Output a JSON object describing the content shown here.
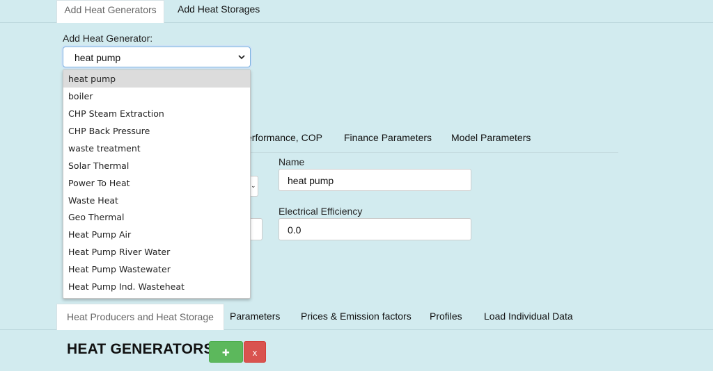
{
  "top_tabs": {
    "add_heat_generators": "Add Heat Generators",
    "add_heat_storages": "Add Heat Storages"
  },
  "generator_select": {
    "label": "Add Heat Generator:",
    "value": "heat pump",
    "options": [
      "heat pump",
      "boiler",
      "CHP Steam Extraction",
      "CHP Back Pressure",
      "waste treatment",
      "Solar Thermal",
      "Power To Heat",
      "Waste Heat",
      "Geo Thermal",
      "Heat Pump Air",
      "Heat Pump River Water",
      "Heat Pump Wastewater",
      "Heat Pump Ind. Wasteheat"
    ],
    "highlighted_index": 0
  },
  "sub_tabs": {
    "performance": "erformance, COP",
    "finance": "Finance Parameters",
    "model": "Model Parameters"
  },
  "form": {
    "name_label": "Name",
    "name_value": "heat pump",
    "eff_label": "Electrical Efficiency",
    "eff_value": "0.0"
  },
  "bottom_tabs": {
    "producers": "Heat Producers and Heat Storage",
    "parameters": "Parameters",
    "prices": "Prices & Emission factors",
    "profiles": "Profiles",
    "load": "Load Individual Data"
  },
  "section": {
    "title": "HEAT GENERATORS",
    "add_label": "✚",
    "delete_label": "x"
  },
  "colors": {
    "background": "#d2ebef",
    "add_button": "#5cb85c",
    "delete_button": "#d9534f"
  }
}
